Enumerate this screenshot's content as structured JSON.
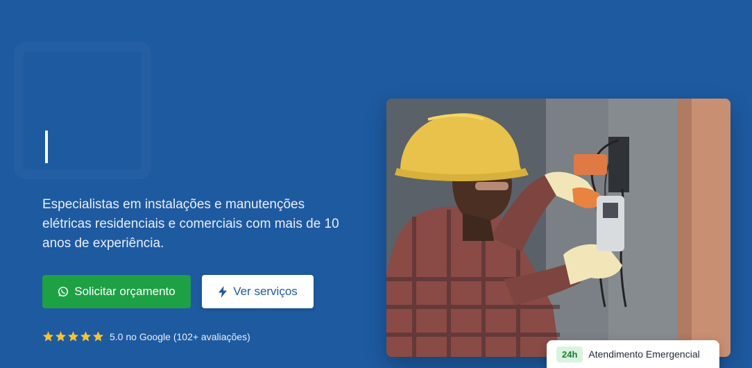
{
  "hero": {
    "subtitle": "Especialistas em instalações e manutenções elétricas residenciais e comerciais com mais de 10 anos de experiência.",
    "primary_button": {
      "label": "Solicitar orçamento",
      "icon": "whatsapp-icon"
    },
    "secondary_button": {
      "label": "Ver serviços",
      "icon": "bolt-icon"
    },
    "rating": {
      "stars": 5,
      "text": "5.0 no Google (102+ avaliações)"
    }
  },
  "photo": {
    "subject": "electrician-working-photo"
  },
  "badge": {
    "tag": "24h",
    "text": "Atendimento Emergencial"
  },
  "colors": {
    "background": "#1e5aa0",
    "primary": "#1ea045",
    "star": "#f6c234"
  }
}
